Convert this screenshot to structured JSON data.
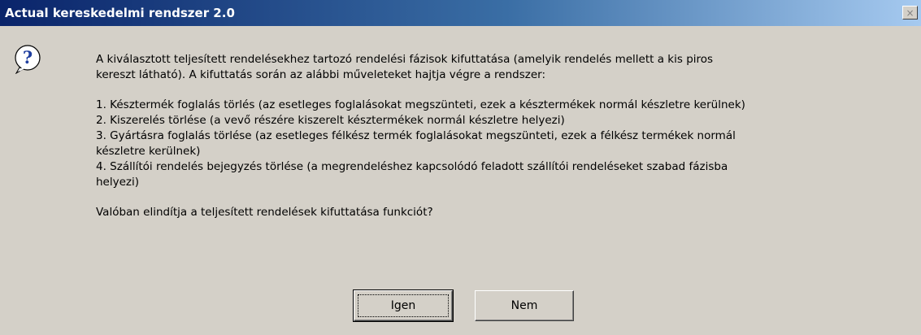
{
  "window": {
    "title": "Actual kereskedelmi rendszer 2.0",
    "close_symbol": "×"
  },
  "icon": "question-icon",
  "message": {
    "intro": [
      "A kiválasztott teljesített rendelésekhez tartozó rendelési fázisok kifuttatása (amelyik rendelés mellett a kis piros",
      "kereszt látható). A kifuttatás során az alábbi műveleteket hajtja végre a rendszer:"
    ],
    "items": [
      "1. Késztermék foglalás törlés (az esetleges foglalásokat megszünteti, ezek a késztermékek normál készletre kerülnek)",
      "2. Kiszerelés törlése (a vevő részére kiszerelt késztermékek normál készletre helyezi)",
      "3. Gyártásra foglalás törlése (az esetleges félkész termék foglalásokat megszünteti, ezek a félkész termékek normál",
      "készletre kerülnek)",
      "4. Szállítói rendelés bejegyzés törlése (a megrendeléshez kapcsolódó feladott szállítói rendeléseket szabad fázisba",
      "helyezi)"
    ],
    "question": "Valóban elindítja a teljesített rendelések kifuttatása funkciót?"
  },
  "buttons": {
    "yes": "Igen",
    "no": "Nem"
  },
  "colors": {
    "dialog_bg": "#d4d0c8",
    "title_start": "#0a246a",
    "title_end": "#a6caf0",
    "icon_blue": "#1f3f9f"
  }
}
